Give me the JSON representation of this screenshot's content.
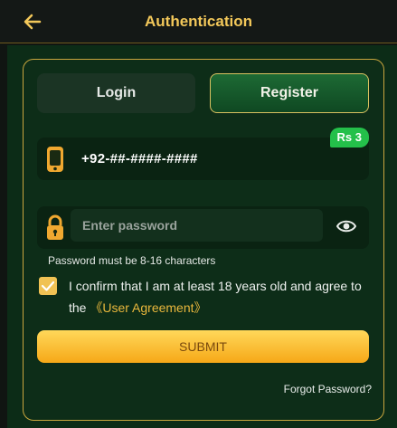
{
  "header": {
    "title": "Authentication",
    "back_icon": "arrow-left-icon"
  },
  "tabs": [
    {
      "label": "Login",
      "active": false
    },
    {
      "label": "Register",
      "active": true
    }
  ],
  "phone": {
    "icon": "phone-icon",
    "value": "+92-##-####-####",
    "badge": "Rs 3"
  },
  "password": {
    "icon": "lock-icon",
    "placeholder": "Enter password",
    "toggle_icon": "eye-icon",
    "hint": "Password must be 8-16 characters"
  },
  "agreement": {
    "checked": true,
    "text": "I confirm that I am at least 18 years old and agree to the",
    "link": "《User Agreement》"
  },
  "submit_label": "SUBMIT",
  "forgot_label": "Forgot Password?",
  "colors": {
    "accent_gold": "#f3c85a",
    "submit_top": "#ffd85a",
    "submit_bottom": "#f6a817",
    "badge_green": "#24c04a",
    "background_green": "#0c2c17"
  }
}
